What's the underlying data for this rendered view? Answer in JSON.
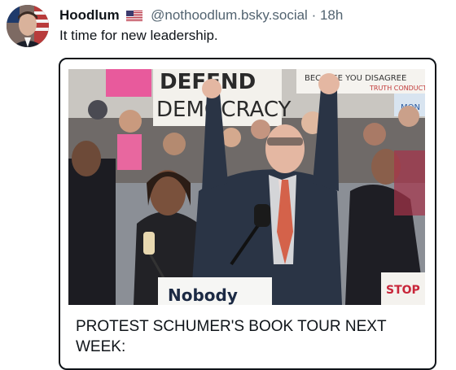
{
  "post": {
    "author_name": "Hoodlum",
    "author_flag_icon": "us-flag-icon",
    "handle": "@nothoodlum.bsky.social",
    "separator": "·",
    "timestamp": "18h",
    "text": "It time for new leadership."
  },
  "card": {
    "photo_signs": {
      "defend_democracy_line1": "DEFEND",
      "defend_democracy_line2": "DEMOCRACY",
      "top_right_sign": "BECAUSE YOU DISAGREE",
      "truth_sign": "TRUTH CONDUCTOR",
      "bottom_sign": "Nobody",
      "stop_sign": "STOP",
      "small_sign": "MON"
    },
    "title": "PROTEST SCHUMER'S BOOK TOUR NEXT WEEK:"
  },
  "colors": {
    "text_primary": "#0f1419",
    "text_secondary": "#536471",
    "card_border": "#0f1419"
  }
}
